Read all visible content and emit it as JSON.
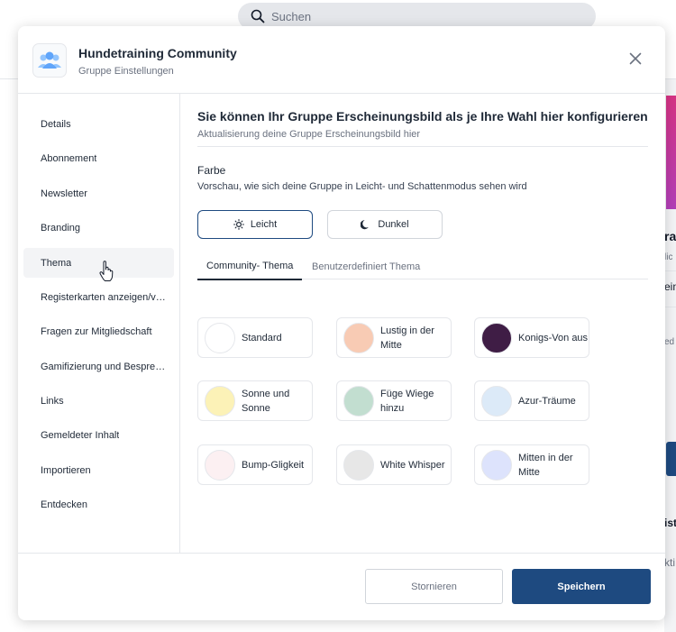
{
  "search": {
    "placeholder": "Suchen"
  },
  "background": {
    "fragment_1": "ra",
    "fragment_2": "lic",
    "fragment_3": "ein",
    "fragment_4": "ed",
    "fragment_5": "ist",
    "fragment_6": "kti"
  },
  "modal": {
    "title": "Hundetraining Community",
    "subtitle": "Gruppe Einstellungen"
  },
  "sidebar": {
    "items": [
      {
        "label": "Details"
      },
      {
        "label": "Abonnement"
      },
      {
        "label": "Newsletter"
      },
      {
        "label": "Branding"
      },
      {
        "label": "Thema"
      },
      {
        "label": "Registerkarten anzeigen/verbergen"
      },
      {
        "label": "Fragen zur Mitgliedschaft"
      },
      {
        "label": "Gamifizierung und Besprechungen"
      },
      {
        "label": "Links"
      },
      {
        "label": "Gemeldeter Inhalt"
      },
      {
        "label": "Importieren"
      },
      {
        "label": "Entdecken"
      }
    ],
    "active_index": 4
  },
  "content": {
    "title": "Sie können Ihr Gruppe Erscheinungsbild als je Ihre Wahl hier konfigurieren",
    "subtitle": "Aktualisierung deine Gruppe Erscheinungsbild hier",
    "color_label": "Farbe",
    "color_desc": "Vorschau, wie sich deine Gruppe in Leicht- und Schattenmodus sehen wird",
    "mode_light": "Leicht",
    "mode_dark": "Dunkel",
    "selected_mode": "Leicht",
    "tab_community": "Community- Thema",
    "tab_custom": "Benutzerdefiniert Thema",
    "themes": [
      {
        "name": "Standard",
        "color": "#ffffff"
      },
      {
        "name": "Lustig in der Mitte",
        "color": "#f8cbb4"
      },
      {
        "name": "Konigs-Von aus",
        "color": "#3f1d45"
      },
      {
        "name": "Sonne und Sonne",
        "color": "#fcf2b7"
      },
      {
        "name": "Füge Wiege hinzu",
        "color": "#c2ded0"
      },
      {
        "name": "Azur-Träume",
        "color": "#dceaf8"
      },
      {
        "name": "Bump-Gligkeit",
        "color": "#fcf0f2"
      },
      {
        "name": "White Whisper",
        "color": "#e7e7e7"
      },
      {
        "name": "Mitten in der Mitte",
        "color": "#dde3fc"
      }
    ]
  },
  "footer": {
    "cancel_label": "Stornieren",
    "save_label": "Speichern"
  },
  "colors": {
    "accent": "#1e4a80"
  }
}
